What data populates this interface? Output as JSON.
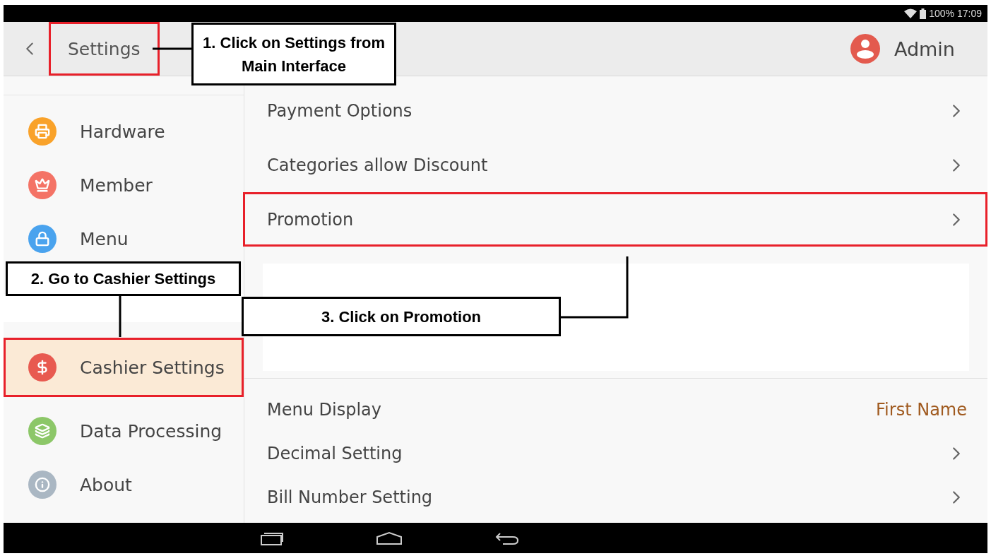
{
  "status_bar": {
    "battery": "100%",
    "time": "17:09"
  },
  "header": {
    "title": "Settings",
    "title_highlighted": true,
    "user": "Admin"
  },
  "sidebar": {
    "groups": [
      {
        "items": [
          {
            "label": "Hardware",
            "color": "#f9a22a",
            "selected": false,
            "highlighted": false
          },
          {
            "label": "Member",
            "color": "#f47366",
            "selected": false,
            "highlighted": false
          },
          {
            "label": "Menu",
            "color": "#4aa3ee",
            "selected": false,
            "highlighted": false
          }
        ]
      },
      {
        "items": [
          {
            "label": "Cashier Settings",
            "color": "#e85a50",
            "selected": true,
            "highlighted": true
          },
          {
            "label": "Data Processing",
            "color": "#8cc768",
            "selected": false,
            "highlighted": false
          },
          {
            "label": "About",
            "color": "#aab7c3",
            "selected": false,
            "highlighted": false
          }
        ]
      }
    ]
  },
  "settings": {
    "groups": [
      {
        "rows": [
          {
            "label": "Payment Options",
            "kind": "link",
            "highlighted": false
          },
          {
            "label": "Categories allow Discount",
            "kind": "link",
            "highlighted": false
          },
          {
            "label": "Promotion",
            "kind": "link",
            "highlighted": true
          }
        ]
      },
      {
        "rows": [
          {
            "label": "Menu Display",
            "kind": "value",
            "value": "First Name",
            "highlighted": false
          },
          {
            "label": "Decimal Setting",
            "kind": "link",
            "highlighted": false
          },
          {
            "label": "Bill Number Setting",
            "kind": "link",
            "highlighted": false
          }
        ]
      }
    ]
  },
  "callouts": [
    {
      "text": "1. Click on Settings from Main Interface"
    },
    {
      "text": "2. Go to Cashier Settings"
    },
    {
      "text": "3. Click on Promotion"
    }
  ]
}
